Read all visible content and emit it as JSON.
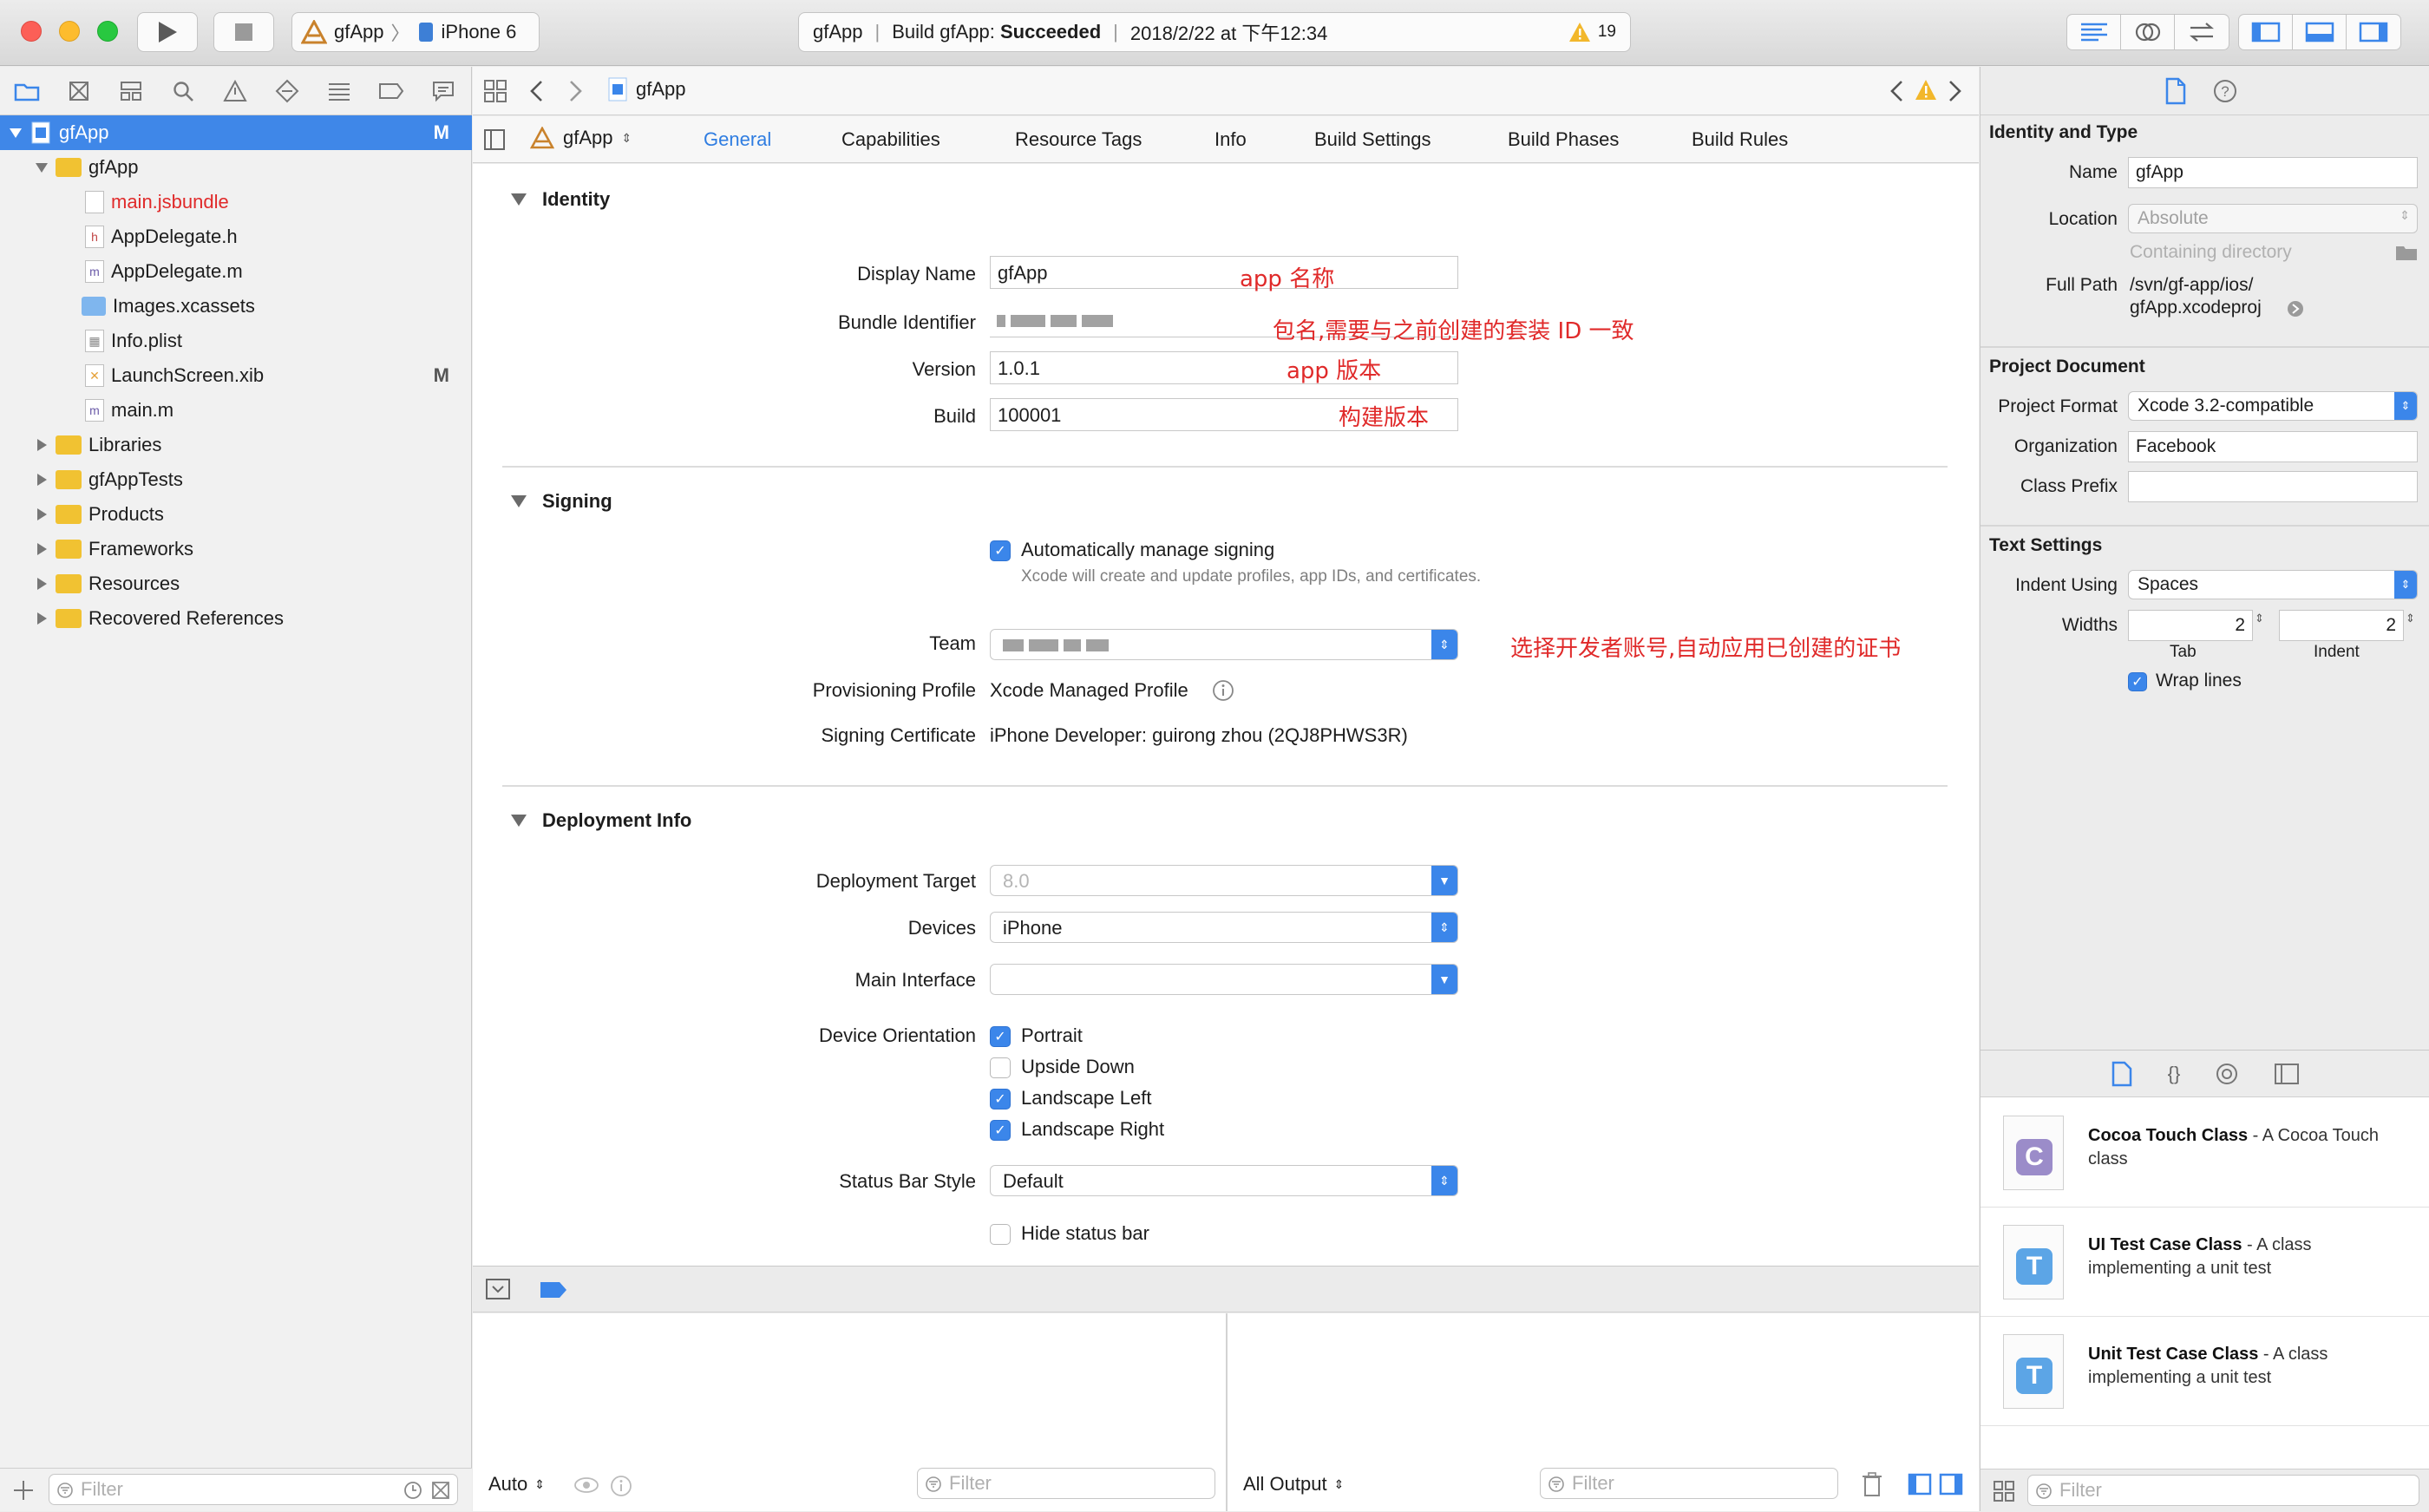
{
  "toolbar": {
    "scheme_target": "gfApp",
    "scheme_device": "iPhone 6",
    "activity_project": "gfApp",
    "activity_build_prefix": "Build gfApp:",
    "activity_build_status": "Succeeded",
    "activity_time": "2018/2/22 at 下午12:34",
    "warning_count": "19"
  },
  "navigator": {
    "items": [
      {
        "label": "gfApp",
        "badge": "M"
      },
      {
        "label": "gfApp"
      },
      {
        "label": "main.jsbundle"
      },
      {
        "label": "AppDelegate.h",
        "icon": "h"
      },
      {
        "label": "AppDelegate.m",
        "icon": "m"
      },
      {
        "label": "Images.xcassets"
      },
      {
        "label": "Info.plist"
      },
      {
        "label": "LaunchScreen.xib",
        "badge": "M"
      },
      {
        "label": "main.m",
        "icon": "m"
      },
      {
        "label": "Libraries"
      },
      {
        "label": "gfAppTests"
      },
      {
        "label": "Products"
      },
      {
        "label": "Frameworks"
      },
      {
        "label": "Resources"
      },
      {
        "label": "Recovered References"
      }
    ],
    "filter_placeholder": "Filter"
  },
  "jumpbar": {
    "file": "gfApp"
  },
  "tabs": {
    "target": "gfApp",
    "items": [
      "General",
      "Capabilities",
      "Resource Tags",
      "Info",
      "Build Settings",
      "Build Phases",
      "Build Rules"
    ]
  },
  "identity": {
    "title": "Identity",
    "display_name_label": "Display Name",
    "display_name": "gfApp",
    "display_name_note": "app 名称",
    "bundle_label": "Bundle Identifier",
    "bundle_note": "包名,需要与之前创建的套装 ID 一致",
    "version_label": "Version",
    "version": "1.0.1",
    "version_note": "app 版本",
    "build_label": "Build",
    "build": "100001",
    "build_note": "构建版本"
  },
  "signing": {
    "title": "Signing",
    "auto_label": "Automatically manage signing",
    "auto_desc": "Xcode will create and update profiles, app IDs, and certificates.",
    "team_label": "Team",
    "team_note": "选择开发者账号,自动应用已创建的证书",
    "profile_label": "Provisioning Profile",
    "profile_value": "Xcode Managed Profile",
    "cert_label": "Signing Certificate",
    "cert_value": "iPhone Developer: guirong zhou (2QJ8PHWS3R)"
  },
  "deployment": {
    "title": "Deployment Info",
    "target_label": "Deployment Target",
    "target_value": "8.0",
    "devices_label": "Devices",
    "devices_value": "iPhone",
    "interface_label": "Main Interface",
    "interface_value": "",
    "orientation_label": "Device Orientation",
    "orientations": [
      {
        "label": "Portrait",
        "checked": true
      },
      {
        "label": "Upside Down",
        "checked": false
      },
      {
        "label": "Landscape Left",
        "checked": true
      },
      {
        "label": "Landscape Right",
        "checked": true
      }
    ],
    "statusbar_label": "Status Bar Style",
    "statusbar_value": "Default",
    "hide_status_label": "Hide status bar"
  },
  "debug": {
    "auto_label": "Auto",
    "filter_placeholder": "Filter",
    "output_label": "All Output"
  },
  "inspector": {
    "identity_title": "Identity and Type",
    "name_label": "Name",
    "name_value": "gfApp",
    "location_label": "Location",
    "location_value": "Absolute",
    "containing": "Containing directory",
    "fullpath_label": "Full Path",
    "fullpath_line1": "/svn/gf-app/ios/",
    "fullpath_line2": "gfApp.xcodeproj",
    "projdoc_title": "Project Document",
    "format_label": "Project Format",
    "format_value": "Xcode 3.2-compatible",
    "org_label": "Organization",
    "org_value": "Facebook",
    "prefix_label": "Class Prefix",
    "prefix_value": "",
    "text_title": "Text Settings",
    "indent_using_label": "Indent Using",
    "indent_using_value": "Spaces",
    "widths_label": "Widths",
    "tab_value": "2",
    "indent_value": "2",
    "tab_caption": "Tab",
    "indent_caption": "Indent",
    "wrap_label": "Wrap lines"
  },
  "library": {
    "items": [
      {
        "title": "Cocoa Touch Class",
        "desc": " - A Cocoa Touch class",
        "glyph": "C",
        "color": "#9b8cc9"
      },
      {
        "title": "UI Test Case Class",
        "desc": " - A class implementing a unit test",
        "glyph": "T",
        "color": "#5ca5e6"
      },
      {
        "title": "Unit Test Case Class",
        "desc": " - A class implementing a unit test",
        "glyph": "T",
        "color": "#5ca5e6"
      }
    ],
    "filter_placeholder": "Filter"
  }
}
